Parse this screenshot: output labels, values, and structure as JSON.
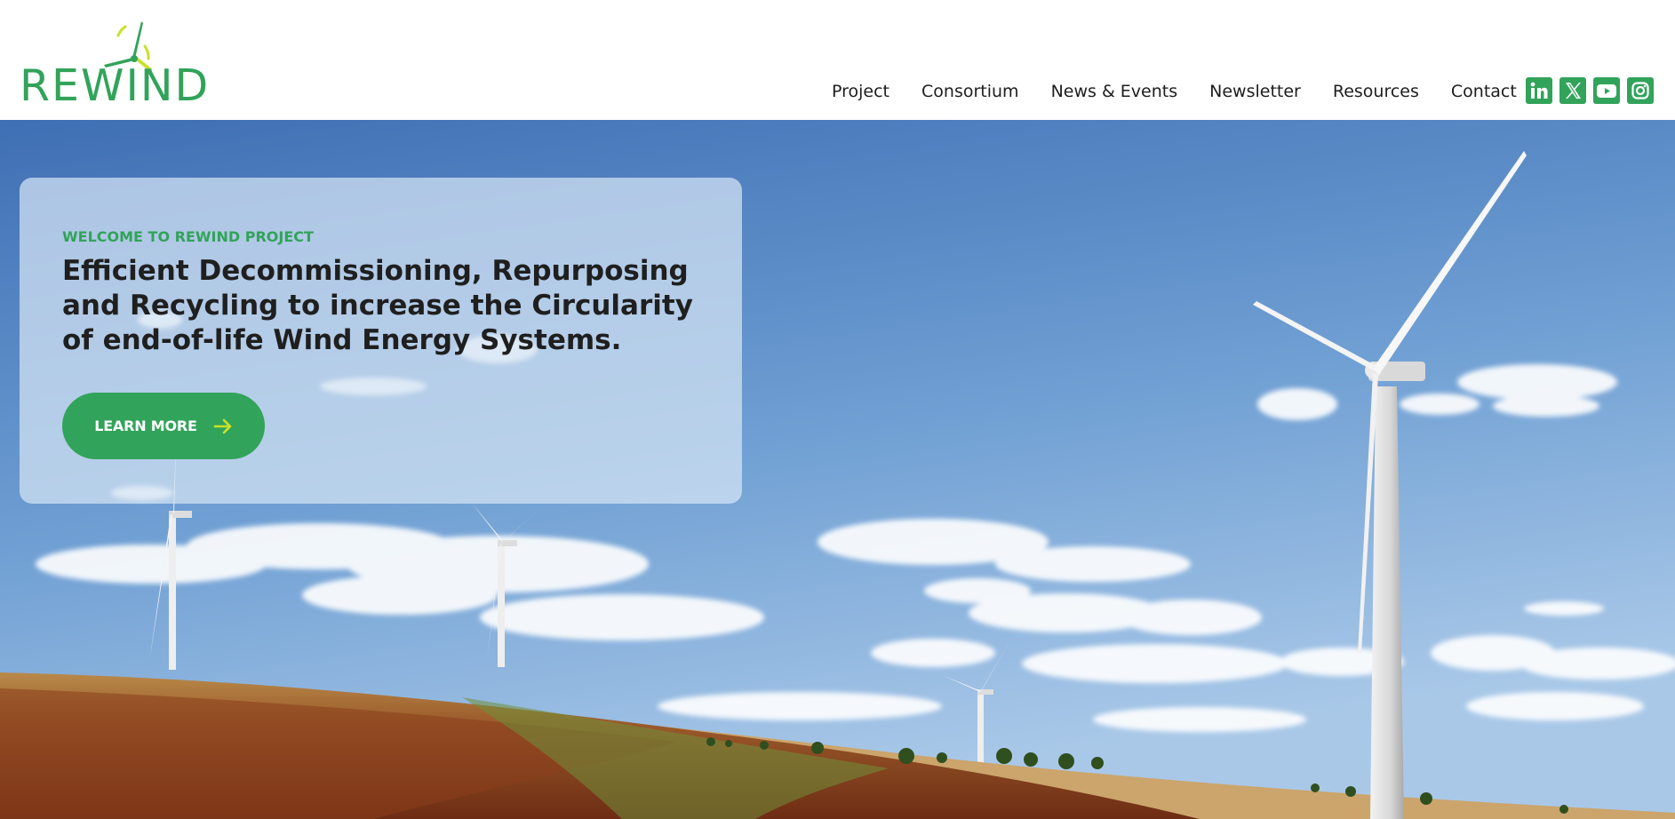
{
  "brand": {
    "name": "REWIND",
    "logo_icon": "wind-turbine-icon",
    "color_primary": "#32a35a",
    "color_accent": "#c8e02a"
  },
  "nav": {
    "items": [
      {
        "label": "Project"
      },
      {
        "label": "Consortium"
      },
      {
        "label": "News & Events"
      },
      {
        "label": "Newsletter"
      },
      {
        "label": "Resources"
      },
      {
        "label": "Contact"
      }
    ]
  },
  "socials": [
    {
      "icon": "linkedin-icon"
    },
    {
      "icon": "x-twitter-icon"
    },
    {
      "icon": "youtube-icon"
    },
    {
      "icon": "instagram-icon"
    }
  ],
  "hero": {
    "eyebrow": "WELCOME TO REWIND PROJECT",
    "headline": "Efficient Decommissioning, Repurposing and Recycling to increase the Circularity of end-of-life Wind Energy Systems.",
    "cta_label": "LEARN MORE",
    "cta_icon": "arrow-right-icon",
    "background": "wind-farm-photo"
  }
}
